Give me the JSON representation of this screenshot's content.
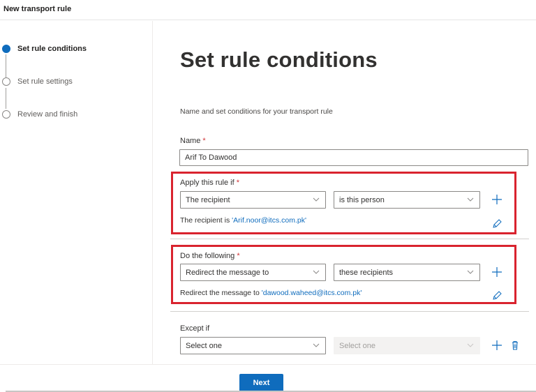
{
  "window": {
    "title": "New transport rule"
  },
  "steps": [
    {
      "label": "Set rule conditions",
      "state": "active"
    },
    {
      "label": "Set rule settings",
      "state": "pending"
    },
    {
      "label": "Review and finish",
      "state": "pending"
    }
  ],
  "main": {
    "title": "Set rule conditions",
    "description": "Name and set conditions for your transport rule",
    "name_field": {
      "label": "Name",
      "required_mark": "*",
      "value": "Arif To Dawood"
    },
    "apply_rule": {
      "label": "Apply this rule if",
      "required_mark": "*",
      "condition": "The recipient",
      "operator": "is this person",
      "summary_prefix": "The recipient is ",
      "summary_value": "'Arif.noor@itcs.com.pk'"
    },
    "do_following": {
      "label": "Do the following",
      "required_mark": "*",
      "action": "Redirect the message to",
      "target": "these recipients",
      "summary_prefix": "Redirect the message to ",
      "summary_value": "'dawood.waheed@itcs.com.pk'"
    },
    "except_if": {
      "label": "Except if",
      "condition_placeholder": "Select one",
      "operator_placeholder": "Select one"
    }
  },
  "footer": {
    "next_label": "Next"
  },
  "colors": {
    "accent": "#0f6cbd",
    "highlight": "#d9232e",
    "required": "#d13438"
  }
}
